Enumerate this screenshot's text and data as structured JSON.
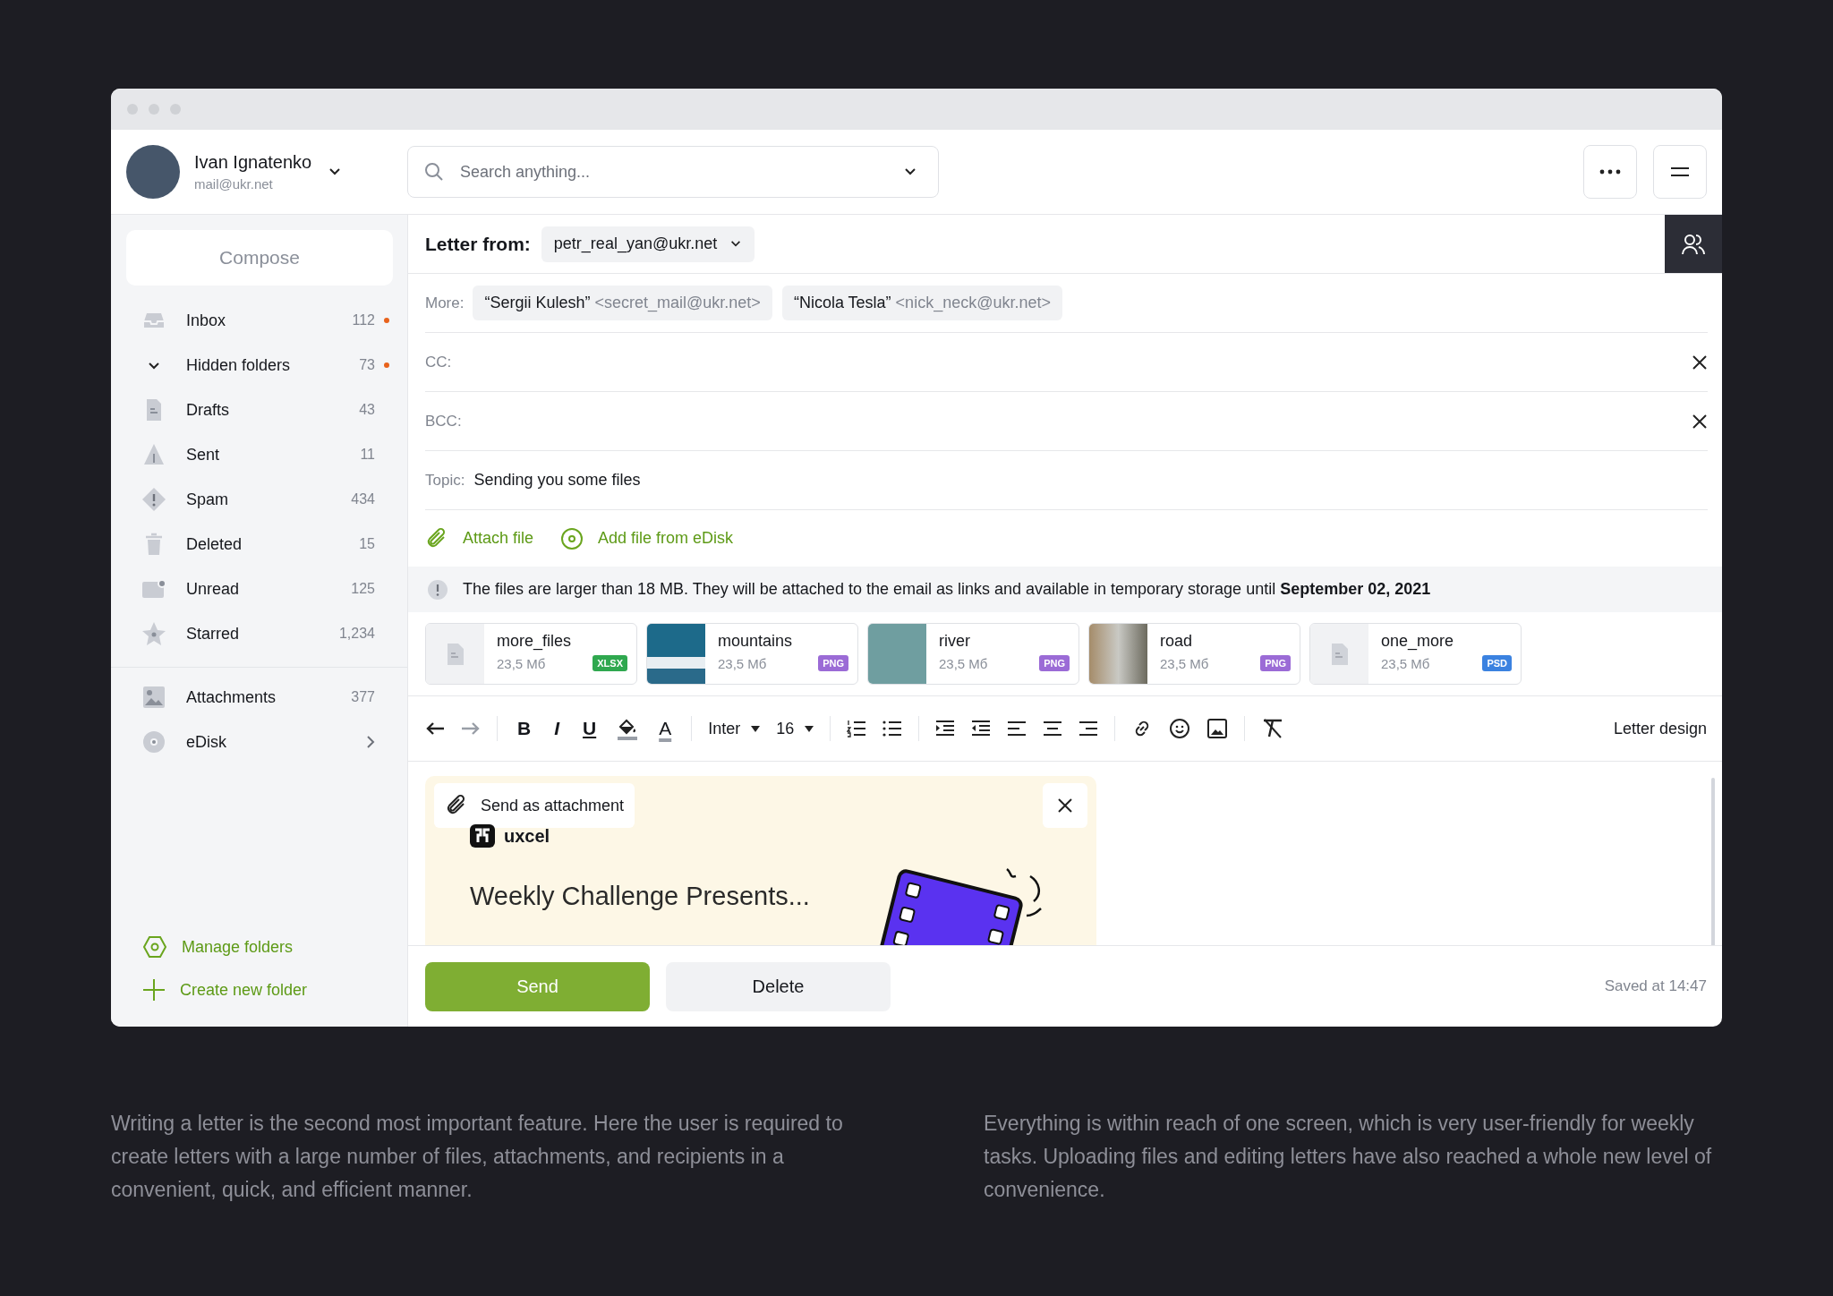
{
  "user": {
    "name": "Ivan Ignatenko",
    "email": "mail@ukr.net"
  },
  "search": {
    "placeholder": "Search anything..."
  },
  "sidebar": {
    "compose": "Compose",
    "folders": [
      {
        "label": "Inbox",
        "count": "112",
        "dot": true,
        "color": "#e8621c"
      },
      {
        "label": "Hidden folders",
        "count": "73",
        "dot": true,
        "color": "#e8621c",
        "expanded": true
      },
      {
        "label": "Drafts",
        "count": "43"
      },
      {
        "label": "Sent",
        "count": "11"
      },
      {
        "label": "Spam",
        "count": "434"
      },
      {
        "label": "Deleted",
        "count": "15"
      },
      {
        "label": "Unread",
        "count": "125"
      },
      {
        "label": "Starred",
        "count": "1,234"
      }
    ],
    "extra": [
      {
        "label": "Attachments",
        "count": "377"
      },
      {
        "label": "eDisk"
      }
    ],
    "actions": [
      "Manage folders",
      "Create new folder"
    ]
  },
  "letter": {
    "from_label": "Letter from:",
    "from": "petr_real_yan@ukr.net",
    "more_label": "More:",
    "recipients": [
      {
        "name": "“Sergii Kulesh”",
        "email": "<secret_mail@ukr.net>"
      },
      {
        "name": "“Nicola Tesla”",
        "email": "<nick_neck@ukr.net>"
      }
    ],
    "cc_label": "CC:",
    "bcc_label": "BCC:",
    "topic_label": "Topic:",
    "topic": "Sending you some files",
    "attach": "Attach file",
    "edisk": "Add file from eDisk",
    "notice": "The files are larger than 18 MB. They will be attached to the email as links and available in temporary storage until **September 02, 2021**",
    "files": [
      {
        "name": "more_files",
        "size": "23,5 Мб",
        "type": "XLSX",
        "color": "#2fa84f",
        "kind": "doc"
      },
      {
        "name": "mountains",
        "size": "23,5 Мб",
        "type": "PNG",
        "color": "#9b6bd6",
        "kind": "photo"
      },
      {
        "name": "river",
        "size": "23,5 Мб",
        "type": "PNG",
        "color": "#9b6bd6",
        "kind": "photo"
      },
      {
        "name": "road",
        "size": "23,5 Мб",
        "type": "PNG",
        "color": "#9b6bd6",
        "kind": "photo"
      },
      {
        "name": "one_more",
        "size": "23,5 Мб",
        "type": "PSD",
        "color": "#3b82e0",
        "kind": "doc"
      }
    ],
    "toolbar": {
      "bold": "B",
      "italic": "I",
      "underline": "U",
      "text_color": "A",
      "font": "Inter",
      "size": "16",
      "letter_design": "Letter design"
    },
    "preview": {
      "chip": "Send as attachment",
      "logo": "uxcel",
      "heading": "Weekly Challenge Presents..."
    },
    "send": "Send",
    "delete": "Delete",
    "saved": "Saved at 14:47"
  },
  "captions": [
    "Writing a letter is the second most important feature. Here the user is required to create letters with a large number of files, attachments, and recipients in a convenient, quick, and efficient manner.",
    "Everything is within reach of one screen, which is very user-friendly for weekly tasks. Uploading files and editing letters have also reached a whole new level of convenience."
  ]
}
